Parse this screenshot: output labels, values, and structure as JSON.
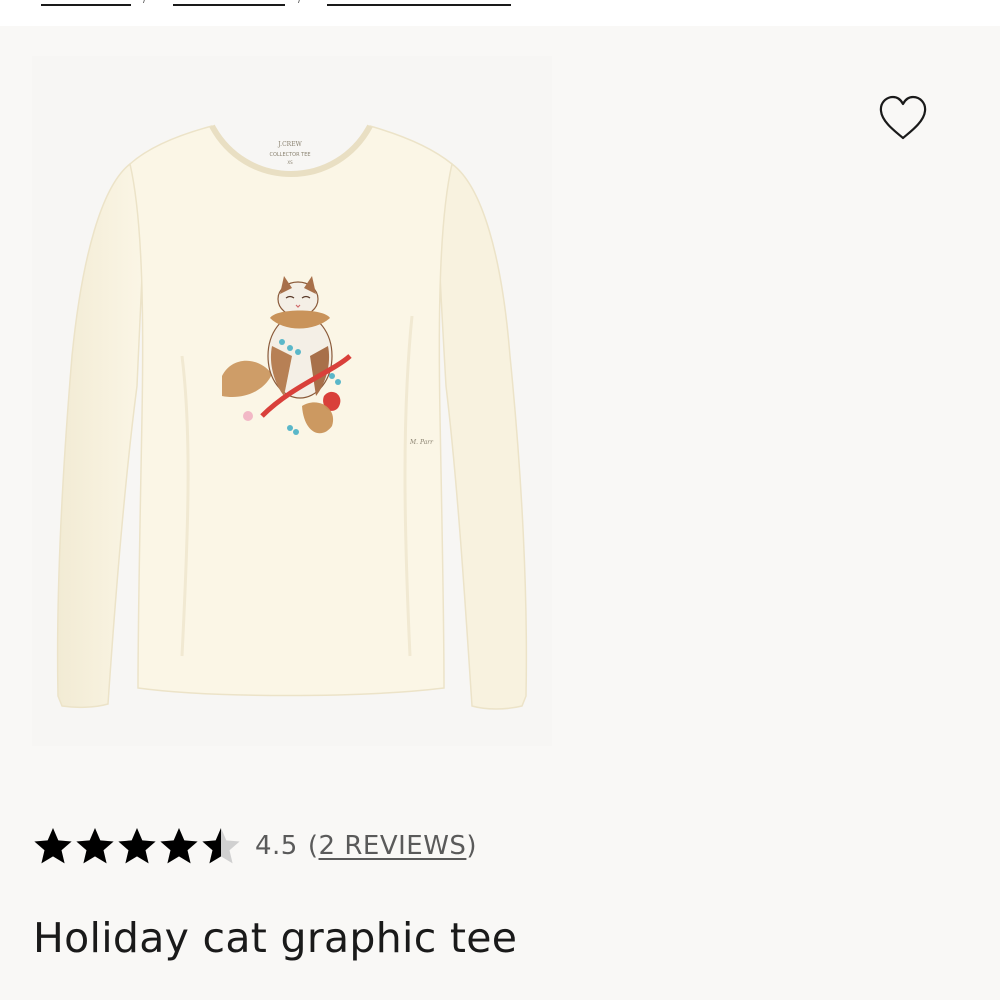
{
  "product": {
    "title": "Holiday cat graphic tee",
    "image_alt": "Holiday cat graphic tee",
    "rating": {
      "value": "4.5",
      "stars_filled": 4.5,
      "stars_total": 5,
      "reviews_open": "(",
      "reviews_label": "2 REVIEWS",
      "reviews_close": ")"
    },
    "wishlist_icon": "heart-outline-icon"
  },
  "colors": {
    "panel_background": "#f9f8f6",
    "tee": "#fbf6e6",
    "star": "#000000",
    "star_empty": "#d0d0d0",
    "muted_text": "#5a5a5a"
  }
}
